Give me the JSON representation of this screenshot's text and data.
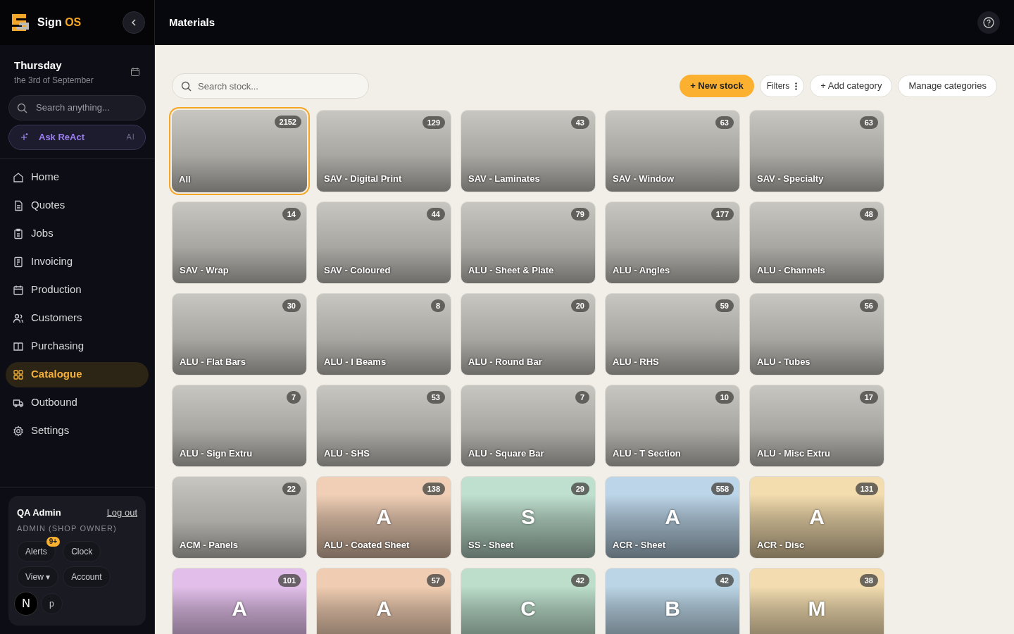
{
  "brand": {
    "name_part1": "Sign",
    "name_part2": "OS"
  },
  "date": {
    "day": "Thursday",
    "full": "the 3rd of September"
  },
  "sidebar_search": {
    "placeholder": "Search anything..."
  },
  "ask": {
    "label": "Ask ReAct",
    "tag": "AI"
  },
  "nav": [
    {
      "label": "Home",
      "selected": false
    },
    {
      "label": "Quotes",
      "selected": false
    },
    {
      "label": "Jobs",
      "selected": false
    },
    {
      "label": "Invoicing",
      "selected": false
    },
    {
      "label": "Production",
      "selected": false
    },
    {
      "label": "Customers",
      "selected": false
    },
    {
      "label": "Purchasing",
      "selected": false
    },
    {
      "label": "Catalogue",
      "selected": true
    },
    {
      "label": "Outbound",
      "selected": false
    },
    {
      "label": "Settings",
      "selected": false
    }
  ],
  "user": {
    "name": "QA Admin",
    "logout": "Log out",
    "role": "ADMIN (SHOP OWNER)",
    "buttons": [
      {
        "label": "Alerts",
        "badge": "9+"
      },
      {
        "label": "Clock"
      },
      {
        "label": "View ▾"
      },
      {
        "label": "Account"
      },
      {
        "label": "p"
      }
    ],
    "avatar_letter": "N"
  },
  "header": {
    "title": "Materials"
  },
  "toolbar": {
    "search_placeholder": "Search stock...",
    "new_stock": "+ New stock",
    "filters": "Filters",
    "add_category": "+ Add category",
    "manage": "Manage categories"
  },
  "categories": [
    {
      "kind": "photo",
      "name": "All",
      "count": "2152",
      "selected": true
    },
    {
      "kind": "photo",
      "name": "SAV - Digital Print",
      "count": "129",
      "selected": false
    },
    {
      "kind": "photo",
      "name": "SAV - Laminates",
      "count": "43",
      "selected": false
    },
    {
      "kind": "photo",
      "name": "SAV - Window",
      "count": "63",
      "selected": false
    },
    {
      "kind": "photo",
      "name": "SAV - Specialty",
      "count": "63",
      "selected": false
    },
    {
      "kind": "photo",
      "name": "SAV - Wrap",
      "count": "14",
      "selected": false
    },
    {
      "kind": "photo",
      "name": "SAV - Coloured",
      "count": "44",
      "selected": false
    },
    {
      "kind": "photo",
      "name": "ALU - Sheet & Plate",
      "count": "79",
      "selected": false
    },
    {
      "kind": "photo",
      "name": "ALU - Angles",
      "count": "177",
      "selected": false
    },
    {
      "kind": "photo",
      "name": "ALU - Channels",
      "count": "48",
      "selected": false
    },
    {
      "kind": "photo",
      "name": "ALU - Flat Bars",
      "count": "30",
      "selected": false
    },
    {
      "kind": "photo",
      "name": "ALU - I Beams",
      "count": "8",
      "selected": false
    },
    {
      "kind": "photo",
      "name": "ALU - Round Bar",
      "count": "20",
      "selected": false
    },
    {
      "kind": "photo",
      "name": "ALU - RHS",
      "count": "59",
      "selected": false
    },
    {
      "kind": "photo",
      "name": "ALU - Tubes",
      "count": "56",
      "selected": false
    },
    {
      "kind": "photo",
      "name": "ALU - Sign Extru",
      "count": "7",
      "selected": false
    },
    {
      "kind": "photo",
      "name": "ALU - SHS",
      "count": "53",
      "selected": false
    },
    {
      "kind": "photo",
      "name": "ALU - Square Bar",
      "count": "7",
      "selected": false
    },
    {
      "kind": "photo",
      "name": "ALU - T Section",
      "count": "10",
      "selected": false
    },
    {
      "kind": "photo",
      "name": "ALU - Misc Extru",
      "count": "17",
      "selected": false
    },
    {
      "kind": "photo",
      "name": "ACM - Panels",
      "count": "22",
      "selected": false
    },
    {
      "kind": "letter",
      "letter": "A",
      "name": "ALU - Coated Sheet",
      "count": "138",
      "color": "#f0cfb6",
      "selected": false
    },
    {
      "kind": "letter",
      "letter": "S",
      "name": "SS - Sheet",
      "count": "29",
      "color": "#bfe0cf",
      "selected": false
    },
    {
      "kind": "letter",
      "letter": "A",
      "name": "ACR - Sheet",
      "count": "558",
      "color": "#bcd5e8",
      "selected": false
    },
    {
      "kind": "letter",
      "letter": "A",
      "name": "ACR - Disc",
      "count": "131",
      "color": "#f3dcae",
      "selected": false
    },
    {
      "kind": "letter",
      "letter": "A",
      "count": "101",
      "color": "#e2bfea",
      "selected": false
    },
    {
      "kind": "letter",
      "letter": "A",
      "count": "57",
      "color": "#f0cdb2",
      "selected": false
    },
    {
      "kind": "letter",
      "letter": "C",
      "count": "42",
      "color": "#bcdecb",
      "selected": false
    },
    {
      "kind": "letter",
      "letter": "B",
      "count": "42",
      "color": "#bbd5e6",
      "selected": false
    },
    {
      "kind": "letter",
      "letter": "M",
      "count": "38",
      "color": "#f3ddb0",
      "selected": false
    }
  ]
}
